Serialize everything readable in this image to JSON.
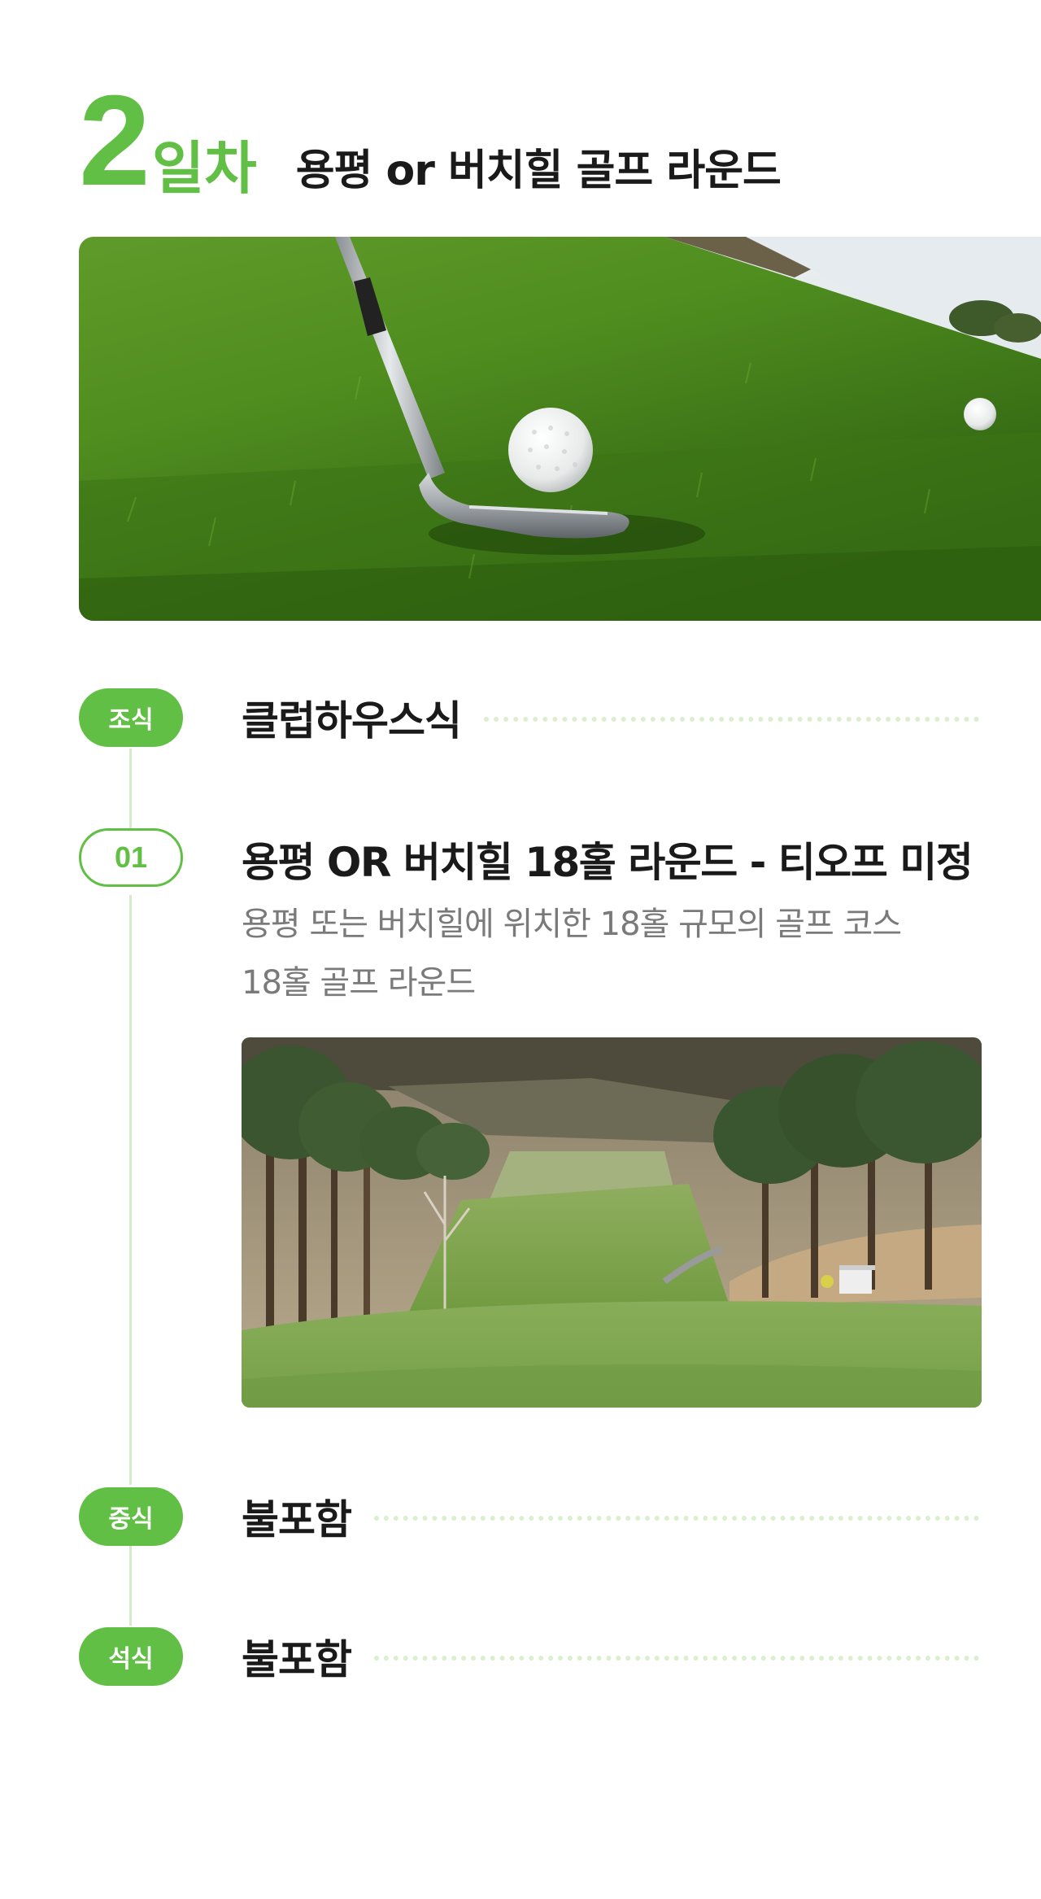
{
  "header": {
    "day_number": "2",
    "day_unit": "일차",
    "title": "용평 or 버치힐 골프 라운드"
  },
  "hero_image": {
    "icon": "golf-ball-and-club-photo"
  },
  "schedule": {
    "breakfast": {
      "badge": "조식",
      "label": "클럽하우스식"
    },
    "item1": {
      "badge": "01",
      "title": "용평 OR 버치힐 18홀 라운드 - 티오프 미정",
      "desc_line1": "용평 또는 버치힐에 위치한 18홀 규모의 골프 코스",
      "desc_line2": "18홀 골프 라운드",
      "image": "golf-course-fairway-photo"
    },
    "lunch": {
      "badge": "중식",
      "label": "불포함"
    },
    "dinner": {
      "badge": "석식",
      "label": "불포함"
    }
  },
  "colors": {
    "accent": "#62bf45",
    "line": "#d6ecc9",
    "dots": "#dbefcf",
    "desc_text": "#7a7a7a"
  }
}
